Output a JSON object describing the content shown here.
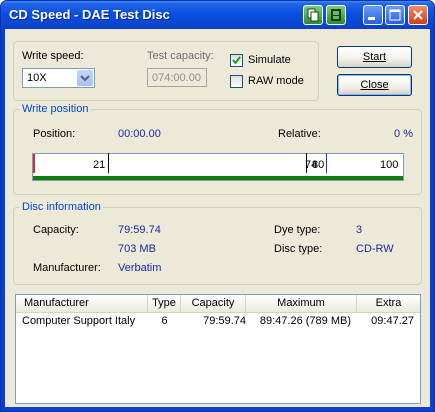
{
  "window": {
    "title": "CD Speed - DAE Test Disc",
    "title_buttons": [
      "copy-icon",
      "tool-icon",
      "minimize-icon",
      "maximize-icon",
      "close-icon"
    ]
  },
  "settings": {
    "write_speed_label": "Write speed:",
    "write_speed_value": "10X",
    "test_capacity_label": "Test capacity:",
    "test_capacity_value": "074:00.00",
    "simulate_label": "Simulate",
    "simulate_checked": true,
    "raw_mode_label": "RAW mode",
    "raw_mode_checked": false,
    "start_label": "Start",
    "close_label": "Close"
  },
  "write_position": {
    "title": "Write position",
    "position_label": "Position:",
    "position_value": "00:00.00",
    "relative_label": "Relative:",
    "relative_value": "0 %",
    "marks": [
      "21",
      "74",
      "80",
      "100"
    ],
    "progress_fraction": 0.0
  },
  "disc_info": {
    "title": "Disc information",
    "capacity_label": "Capacity:",
    "capacity_time": "79:59.74",
    "capacity_size": "703 MB",
    "manufacturer_label": "Manufacturer:",
    "manufacturer_value": "Verbatim",
    "dye_type_label": "Dye type:",
    "dye_type_value": "3",
    "disc_type_label": "Disc type:",
    "disc_type_value": "CD-RW"
  },
  "table": {
    "columns": [
      "Manufacturer",
      "Type",
      "Capacity",
      "Maximum",
      "Extra"
    ],
    "rows": [
      [
        "Computer Support Italy",
        "6",
        "79:59.74",
        "89:47.26 (789 MB)",
        "09:47.27"
      ]
    ]
  },
  "colors": {
    "titlebar": "#0a50df",
    "group_title": "#0046d5",
    "value_text": "#1d2a9f",
    "progress_green": "#0e7d0e",
    "marker_red": "#c83232"
  }
}
